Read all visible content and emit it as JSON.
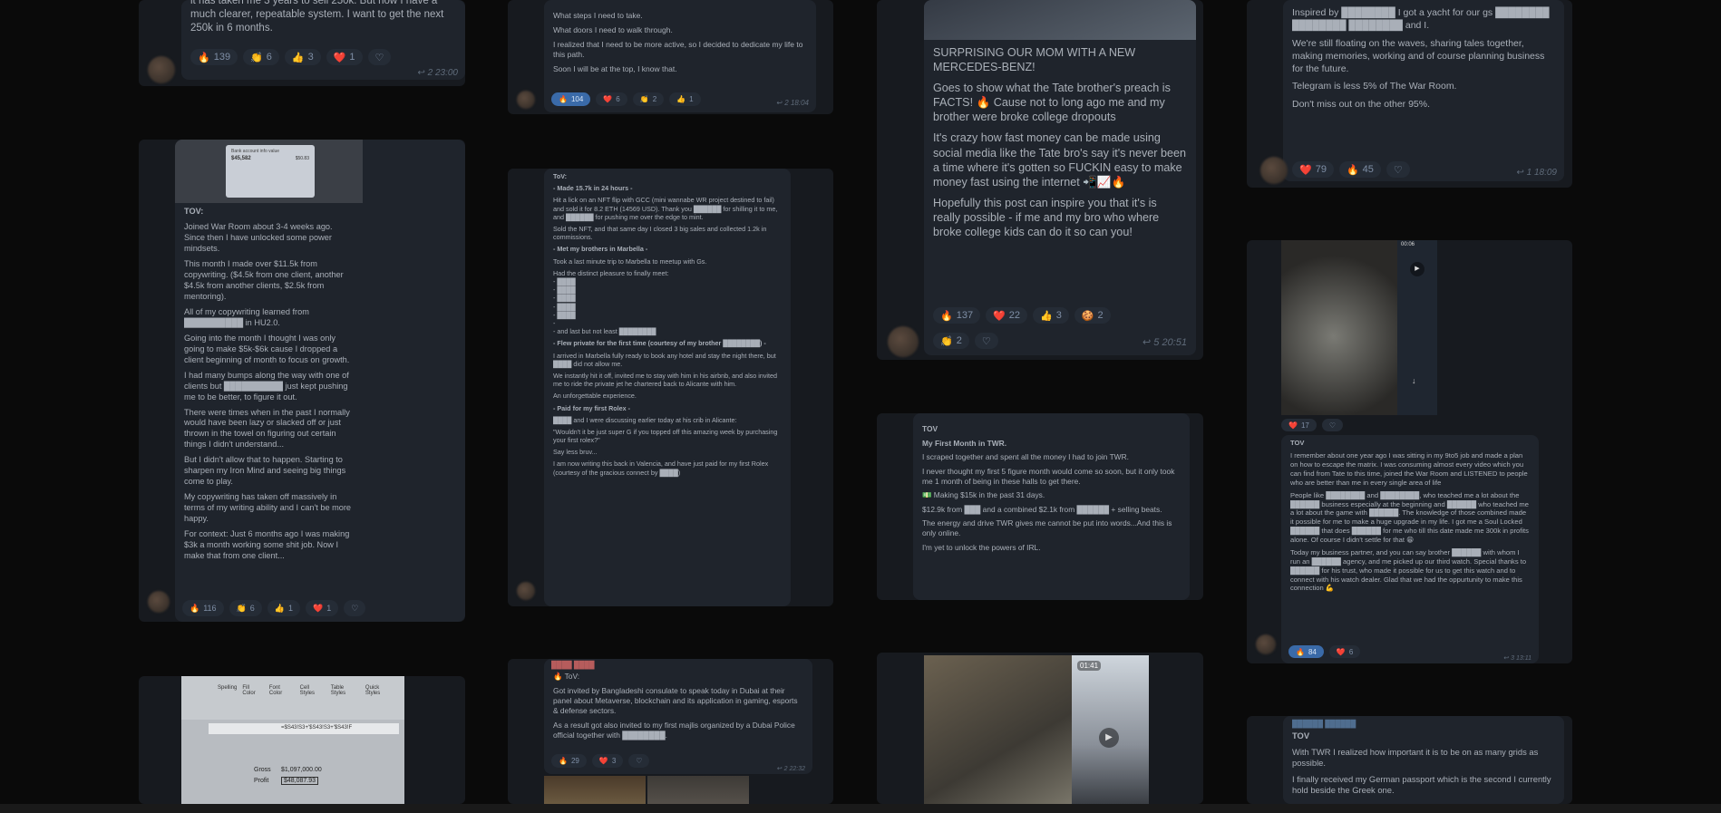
{
  "col1": {
    "top": {
      "text": "it has taken me 3 years to sell 250k. But now I have a much clearer, repeatable system. I want to get the next 250k in 6 months.",
      "reactions": [
        {
          "emoji": "🔥",
          "count": "139"
        },
        {
          "emoji": "👏",
          "count": "6"
        },
        {
          "emoji": "👍",
          "count": "3"
        },
        {
          "emoji": "❤️",
          "count": "1"
        }
      ],
      "meta": "2 23:00"
    },
    "middle": {
      "thumb_title": "Bank account info value",
      "thumb_value": "$45,582",
      "thumb_value2": "$50.83",
      "lines": [
        "TOV:",
        "",
        "Joined War Room about 3-4 weeks ago. Since then I have unlocked some power mindsets.",
        "",
        "This month I made over $11.5k from copywriting. ($4.5k from one client, another $4.5k from another clients, $2.5k from mentoring).",
        "",
        "All of my copywriting learned from ██████████ in HU2.0.",
        "",
        "Going into the month I thought I was only going to make $5k-$6k cause I dropped a client beginning of month to focus on growth.",
        "",
        "I had many bumps along the way with one of clients but ██████████ just kept pushing me to be better, to figure it out.",
        "",
        "There were times when in the past I normally would have been lazy or slacked off or just thrown in the towel on figuring out certain things I didn't understand...",
        "",
        "But I didn't allow that to happen. Starting to sharpen my Iron Mind and seeing big things come to play.",
        "",
        "My copywriting has taken off massively in terms of my writing ability and I can't be more happy.",
        "",
        "For context: Just 6 months ago I was making $3k a month working some shit job. Now I make that from one client..."
      ],
      "reactions": [
        {
          "emoji": "🔥",
          "count": "116"
        },
        {
          "emoji": "👏",
          "count": "6"
        },
        {
          "emoji": "👍",
          "count": "1"
        },
        {
          "emoji": "❤️",
          "count": "1"
        }
      ]
    },
    "bottom": {
      "ribbon": [
        "Spelling",
        "Fill Color",
        "Font Color",
        "Cell Styles",
        "Table Styles",
        "Quick Styles"
      ],
      "formula": "=$S43!S3+'$S43!S3+'$S43!F",
      "row_labels": [
        "Gross",
        "Profit"
      ],
      "row_values": [
        "$1,097,000.00",
        "$48,087.93"
      ]
    }
  },
  "col2": {
    "top": {
      "lines": [
        "What steps I need to take.",
        "",
        "What doors I need to walk through.",
        "",
        "I realized that I need to be more active, so I decided to dedicate my life to this path.",
        "",
        "Soon I will be at the top, I know that."
      ],
      "reactions": [
        {
          "emoji": "🔥",
          "count": "104",
          "active": true
        },
        {
          "emoji": "❤️",
          "count": "6"
        },
        {
          "emoji": "👏",
          "count": "2"
        },
        {
          "emoji": "👍",
          "count": "1"
        }
      ],
      "meta": "2 18:04"
    },
    "middle": {
      "lines": [
        "ToV:",
        "",
        "- Made 15.7k in 24 hours -",
        "",
        "Hit a lick on an NFT flip with GCC (mini wannabe WR project destined to fail) and sold it for 8.2 ETH (14569 USD). Thank you ██████ for shilling it to me, and ██████ for pushing me over the edge to mint.",
        "",
        "Sold the NFT, and that same day I closed 3 big sales and collected 1.2k in commissions.",
        "",
        "- Met my brothers in Marbella -",
        "",
        "Took a last minute trip to Marbella to meetup with Gs.",
        "",
        "Had the distinct pleasure to finally meet:",
        "- ████",
        "- ████",
        "- ████",
        "- ████",
        "- ████",
        "-",
        "- and last but not least ████████",
        "",
        "- Flew private for the first time (courtesy of my brother ████████) -",
        "",
        "I arrived in Marbella fully ready to book any hotel and stay the night there, but ████ did not allow me.",
        "",
        "We instantly hit it off, invited me to stay with him in his airbnb, and also invited me to ride the private jet he chartered back to Alicante with him.",
        "",
        "An unforgettable experience.",
        "",
        "- Paid for my first Rolex -",
        "",
        "████ and I were discussing earlier today at his crib in Alicante:",
        "",
        "\"Wouldn't it be just super G if you topped off this amazing week by purchasing your first rolex?\"",
        "",
        "Say less bruv...",
        "",
        "I am now writing this back in Valencia, and have just paid for my first Rolex (courtesy of the gracious connect by ████)"
      ]
    },
    "bottom": {
      "name": "████ ████",
      "lines": [
        "🔥 ToV:",
        "",
        "Got invited by Bangladeshi consulate to speak today in Dubai at their panel about Metaverse, blockchain and its application in gaming, esports & defense sectors.",
        "",
        "As a result got also invited to my first majlis organized by a Dubai Police official together with ████████."
      ],
      "reactions": [
        {
          "emoji": "🔥",
          "count": "29"
        },
        {
          "emoji": "❤️",
          "count": "3"
        }
      ],
      "meta": "2 22:32"
    }
  },
  "col3": {
    "top": {
      "lines": [
        "SURPRISING OUR MOM WITH A NEW MERCEDES-BENZ!",
        "",
        "Goes to show what the Tate brother's preach is FACTS! 🔥 Cause not to long ago me and my brother were broke college dropouts",
        "",
        "It's crazy how fast money can be made using social media like the Tate bro's say it's never been a time where it's gotten so FUCKIN easy to make money fast using the internet 📲📈🔥",
        "",
        "Hopefully this post can inspire you that it's is really possible - if me and my bro who where broke college kids can do it so can you!"
      ],
      "reactions": [
        {
          "emoji": "🔥",
          "count": "137"
        },
        {
          "emoji": "❤️",
          "count": "22"
        },
        {
          "emoji": "👍",
          "count": "3"
        },
        {
          "emoji": "🍪",
          "count": "2"
        }
      ],
      "reactions2": [
        {
          "emoji": "👏",
          "count": "2"
        }
      ],
      "meta": "5 20:51"
    },
    "middle": {
      "lines": [
        "TOV",
        "",
        "My First Month in TWR.",
        "",
        "I scraped together and spent all the money I had to join TWR.",
        "",
        "I never thought my first 5 figure month would come so soon, but it only took me 1 month of being in these halls to get there.",
        "",
        "💵 Making $15k in the past 31 days.",
        "",
        "$12.9k from ███ and a combined $2.1k from ██████ + selling beats.",
        "",
        "The energy and drive TWR gives me cannot be put into words...And this is only online.",
        "",
        "I'm yet to unlock the powers of IRL."
      ]
    },
    "bottom": {
      "video_time": "01:41"
    }
  },
  "col4": {
    "top": {
      "lines": [
        "Inspired by ████████ I got a yacht for our gs ████████ ████████ ████████ and I.",
        "",
        "We're still floating on the waves, sharing tales together, making memories, working and of course planning business for the future.",
        "",
        "Telegram is less 5% of The War Room.",
        "",
        "Don't miss out on the other 95%."
      ],
      "reactions": [
        {
          "emoji": "❤️",
          "count": "79"
        },
        {
          "emoji": "🔥",
          "count": "45"
        }
      ],
      "meta": "1 18:09"
    },
    "middle": {
      "video_time": "00:06",
      "reactions_top": [
        {
          "emoji": "❤️",
          "count": "17"
        }
      ],
      "lines": [
        "TOV",
        "",
        "I remember about one year ago I was sitting in my 9to5 job and made a plan on how to escape the matrix. I was consuming almost every video which you can find from Tate to this time, joined the War Room and LISTENED to people who are better than me in every single area of life",
        "",
        "People like ████████ and ████████, who teached me a lot about the ██████ business especially at the beginning and ██████ who teached me a lot about the game with ██████. The knowledge of those combined made it possible for me to make a huge upgrade in my life. I got me a Soul Locked ██████ that does ██████ for me who till this date made me 300k in profits alone. Of course I didn't settle for that 😁",
        "",
        "Today my business partner, and you can say brother ██████ with whom I run an ██████ agency, and me picked up our third watch. Special thanks to ██████ for his trust, who made it possible for us to get this watch and to connect with his watch dealer. Glad that we had the oppurtunity to make this connection 💪"
      ],
      "reactions": [
        {
          "emoji": "🔥",
          "count": "84",
          "active": true
        },
        {
          "emoji": "❤️",
          "count": "6"
        }
      ],
      "meta": "3 13:11"
    },
    "bottom": {
      "name": "██████ ██████",
      "lines": [
        "TOV",
        "",
        "With TWR I realized how important it is to be on as many grids as possible.",
        "",
        "I finally received my German passport which is the second I currently hold beside the Greek one."
      ]
    }
  }
}
